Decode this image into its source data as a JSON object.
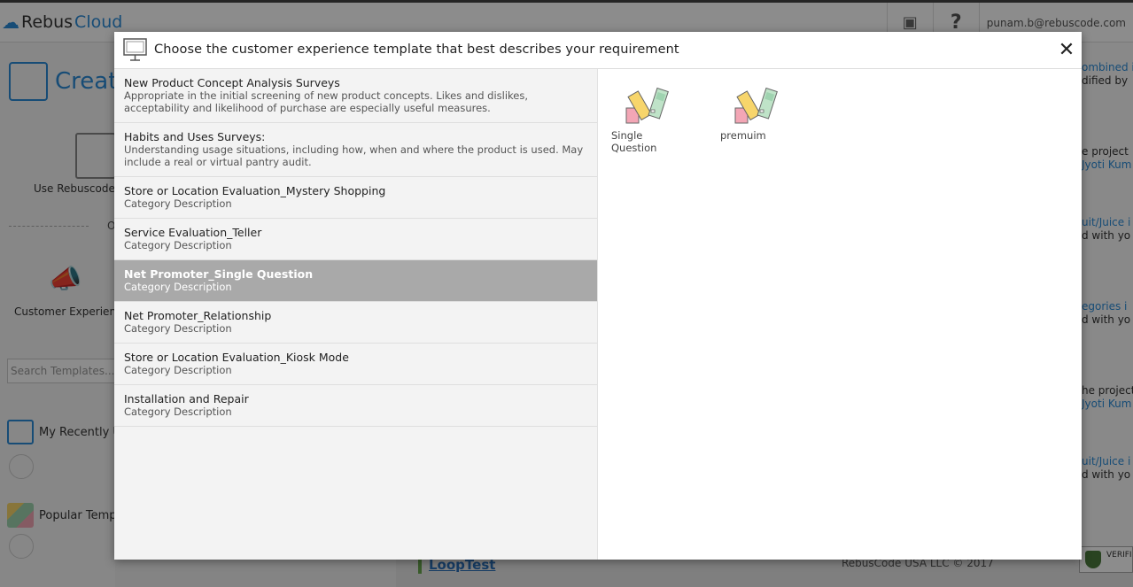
{
  "background": {
    "logo": {
      "part1": "Rebus",
      "part2": "Cloud"
    },
    "user_email": "punam.b@rebuscode.com",
    "create_title": "Create",
    "use_rebus_label": "Use Rebuscode",
    "or_label": "O",
    "cx_label": "Customer Experien",
    "search_placeholder": "Search Templates...",
    "recent_label": "My Recently U",
    "popular_label": "Popular Temp",
    "right_snippets": [
      "ombined i",
      "dified by",
      "e project",
      "Jyoti Kum",
      "uit/Juice i",
      "d with yo",
      "egories i",
      "d with yo",
      "he project",
      "Jyoti Kum",
      "uit/Juice i",
      "d with yo"
    ],
    "loop_test": "LoopTest",
    "copyright": "RebusCode USA LLC © 2017",
    "verified": "VERIFI"
  },
  "modal": {
    "title": "Choose the customer experience template that best describes your requirement",
    "categories": [
      {
        "title": "New Product Concept Analysis Surveys",
        "desc": "Appropriate in the initial screening of new product concepts. Likes and dislikes, acceptability and likelihood of purchase are especially useful measures.",
        "active": false
      },
      {
        "title": "Habits and Uses Surveys:",
        "desc": "Understanding usage situations, including how, when and where the product is used. May include a real or virtual pantry audit.",
        "active": false
      },
      {
        "title": "Store or Location Evaluation_Mystery Shopping",
        "desc": "Category Description",
        "active": false
      },
      {
        "title": "Service Evaluation_Teller",
        "desc": "Category Description",
        "active": false
      },
      {
        "title": "Net Promoter_Single Question",
        "desc": "Category Description",
        "active": true
      },
      {
        "title": "Net Promoter_Relationship",
        "desc": "Category Description",
        "active": false
      },
      {
        "title": "Store or Location Evaluation_Kiosk Mode",
        "desc": "Category Description",
        "active": false
      },
      {
        "title": "Installation and Repair",
        "desc": "Category Description",
        "active": false
      }
    ],
    "templates": [
      {
        "label": "Single Question",
        "icon": "swatch-icon"
      },
      {
        "label": "premuim",
        "icon": "swatch-icon"
      }
    ]
  },
  "colors": {
    "accent": "#2a8bd8",
    "active_row": "#a9a9a9",
    "list_bg": "#f3f3f3"
  }
}
